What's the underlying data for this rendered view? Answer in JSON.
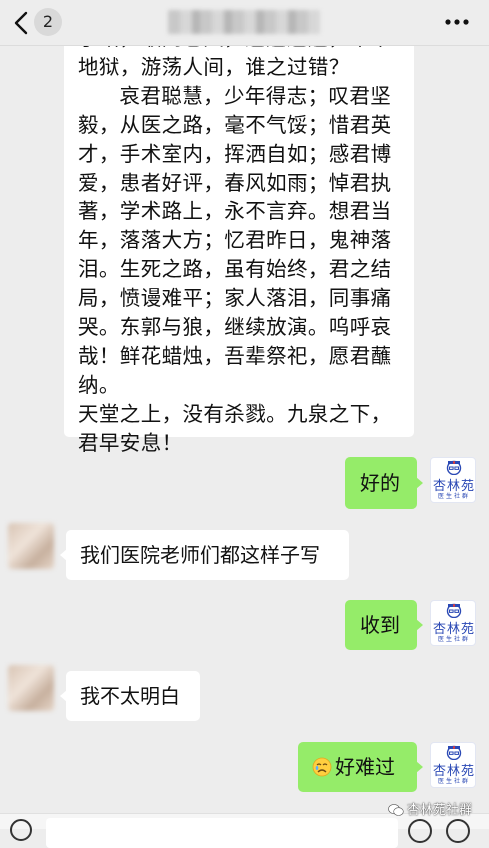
{
  "header": {
    "unread_count": "2"
  },
  "messages": [
    {
      "id": "poem",
      "side": "left",
      "lines": [
        "了结，敢问苍天，魍魉魍魉，不下",
        "地狱，游荡人间，谁之过错？",
        "      哀君聪慧，少年得志；叹君坚",
        "毅，从医之路，毫不气馁；惜君英",
        "才，手术室内，挥洒自如；感君博",
        "爱，患者好评，春风如雨；悼君执",
        "著，学术路上，永不言弃。想君当",
        "年，落落大方；忆君昨日，鬼神落",
        "泪。生死之路，虽有始终，君之结",
        "局，愤谩难平；家人落泪，同事痛",
        "哭。东郭与狼，继续放演。呜呼哀",
        "哉！鲜花蜡烛，吾辈祭祀，愿君蘸",
        "纳。",
        "天堂之上，没有杀戮。九泉之下，",
        "君早安息！"
      ]
    },
    {
      "id": "m1",
      "side": "right",
      "text": "好的"
    },
    {
      "id": "m2",
      "side": "left",
      "text": "我们医院老师们都这样子写"
    },
    {
      "id": "m3",
      "side": "right",
      "text": "收到"
    },
    {
      "id": "m4",
      "side": "left",
      "text": "我不太明白"
    },
    {
      "id": "m5",
      "side": "right",
      "text": "好难过",
      "emoji": "sad-face-emoji"
    }
  ],
  "brand_avatar": {
    "name": "杏林苑",
    "sub": "医生社群"
  },
  "watermark": {
    "text": "杏林苑社群"
  },
  "colors": {
    "background": "#ededed",
    "incoming_bubble": "#ffffff",
    "outgoing_bubble": "#95ec69",
    "brand_blue": "#2b49b5"
  },
  "icons": {
    "back": "chevron-left-icon",
    "more": "more-dots-icon",
    "voice": "voice-icon",
    "emoji": "emoji-icon",
    "plus": "plus-icon",
    "watermark_logo": "wechat-logo-icon"
  }
}
